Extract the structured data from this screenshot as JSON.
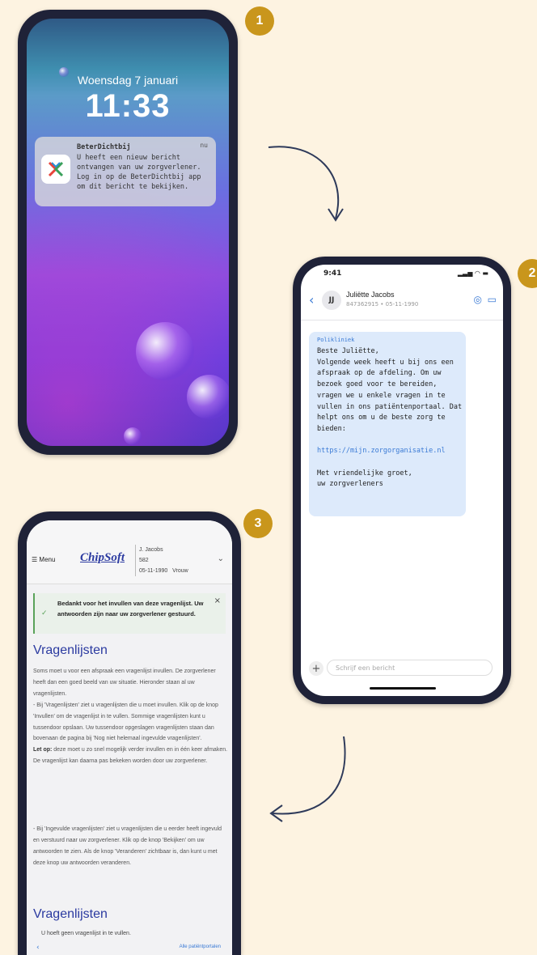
{
  "badges": [
    "1",
    "2",
    "3"
  ],
  "lockscreen": {
    "date": "Woensdag 7 januari",
    "time": "11:33",
    "notification": {
      "app": "BeterDichtbij",
      "time": "nu",
      "body": "U heeft een nieuw bericht ontvangen van uw zorgverlener. Log in op de BeterDichtbij app om dit bericht te bekijken."
    }
  },
  "chat": {
    "status_time": "9:41",
    "contact_initials": "JJ",
    "contact_name": "Juliëtte Jacobs",
    "contact_sub": "847362915 • 05-11-1990",
    "message": {
      "org": "Polikliniek",
      "body_1": "Beste Juliëtte,\nVolgende week heeft u bij ons een afspraak op de afdeling. Om uw bezoek goed voor te bereiden, vragen we u enkele vragen in te vullen in ons patiëntenportaal. Dat helpt ons om u de beste zorg te bieden:",
      "link": "https://mijn.zorgorganisatie.nl",
      "body_2": "Met vriendelijke groet,\nuw zorgverleners"
    },
    "input_placeholder": "Schrijf een bericht"
  },
  "portal": {
    "menu_label": "Menu",
    "logo": "ChipSoft",
    "patient": {
      "name": "J. Jacobs",
      "number": "582",
      "dob": "05-11-1990",
      "gender": "Vrouw"
    },
    "alert": "Bedankt voor het invullen van deze vragenlijst. Uw antwoorden zijn naar uw zorgverlener gestuurd.",
    "heading1": "Vragenlijsten",
    "para1": "Soms moet u voor een afspraak een vragenlijst invullen. De zorgverlener heeft dan een goed beeld van uw situatie. Hieronder staan al uw vragenlijsten.\n- Bij 'Vragenlijsten' ziet u vragenlijsten die u moet invullen. Klik op de knop 'Invullen' om de vragenlijst in te vullen. Sommige vragenlijsten kunt u tussendoor opslaan. Uw tussendoor opgeslagen vragenlijsten staan dan bovenaan de pagina bij 'Nog niet helemaal ingevulde vragenlijsten'.",
    "note_label": "Let op:",
    "note_text": " deze moet u zo snel mogelijk verder invullen en in één keer afmaken. De vragenlijst kan daarna pas bekeken worden door uw zorgverlener.",
    "para2": "- Bij 'Ingevulde vragenlijsten' ziet u vragenlijsten die u eerder heeft ingevuld en verstuurd naar uw zorgverlener. Klik op de knop 'Bekijken' om uw antwoorden te zien. Als de knop 'Veranderen' zichtbaar is, dan kunt u met deze knop uw antwoorden veranderen.",
    "heading2": "Vragenlijsten",
    "empty_text": "U hoeft geen vragenlijst in te vullen.",
    "all_portals": "Alle patiëntportalen"
  },
  "colors": {
    "badge": "#c9961c",
    "accent": "#3a7ad5",
    "arrow": "#2e3a5a",
    "heading": "#2b3aa0"
  }
}
